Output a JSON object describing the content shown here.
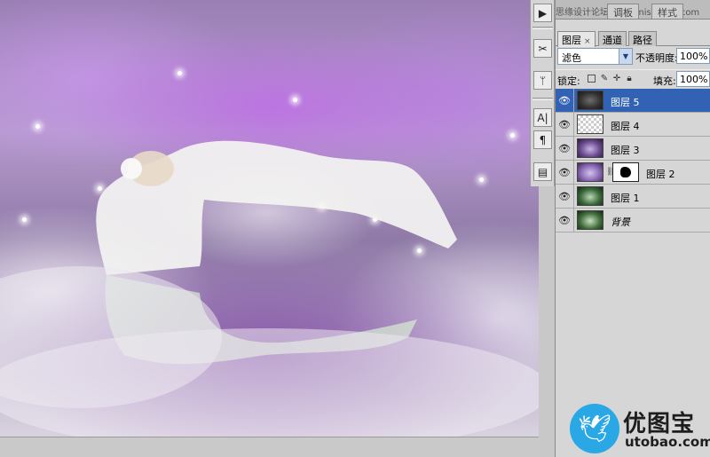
{
  "top_tabs": [
    {
      "label": "调板"
    },
    {
      "label": "样式"
    }
  ],
  "header": {
    "watermark_text": "思缘设计论坛 www.missyuan.com"
  },
  "layers_panel": {
    "tabs": [
      {
        "label": "图层",
        "close": "×",
        "active": true
      },
      {
        "label": "通道",
        "active": false
      },
      {
        "label": "路径",
        "active": false
      }
    ],
    "blend_mode": "滤色",
    "opacity_label": "不透明度:",
    "opacity_value": "100%",
    "lock_label": "锁定:",
    "fill_label": "填充:",
    "fill_value": "100%",
    "layers": [
      {
        "name": "图层 5",
        "thumb": "dark-smoke",
        "visible": true,
        "selected": true,
        "has_mask": false
      },
      {
        "name": "图层 4",
        "thumb": "transparent",
        "visible": true,
        "selected": false,
        "has_mask": false
      },
      {
        "name": "图层 3",
        "thumb": "purple-scene",
        "visible": true,
        "selected": false,
        "has_mask": false
      },
      {
        "name": "图层 2",
        "thumb": "purple-scene",
        "visible": true,
        "selected": false,
        "has_mask": true
      },
      {
        "name": "图层 1",
        "thumb": "green-scene",
        "visible": true,
        "selected": false,
        "has_mask": false
      },
      {
        "name": "背景",
        "thumb": "green-scene",
        "visible": true,
        "selected": false,
        "has_mask": false,
        "italic": true
      }
    ]
  },
  "toolbox_icons": [
    "play-icon",
    "scissors-tool-icon",
    "brush-tool-icon",
    "character-icon",
    "paragraph-icon",
    "layer-comps-icon"
  ],
  "brand": {
    "name": "优图宝",
    "url": "utobao.com",
    "color": "#2aa8e6"
  },
  "colors": {
    "selected_layer": "#3162b3",
    "panel_bg": "#d6d6d6"
  }
}
